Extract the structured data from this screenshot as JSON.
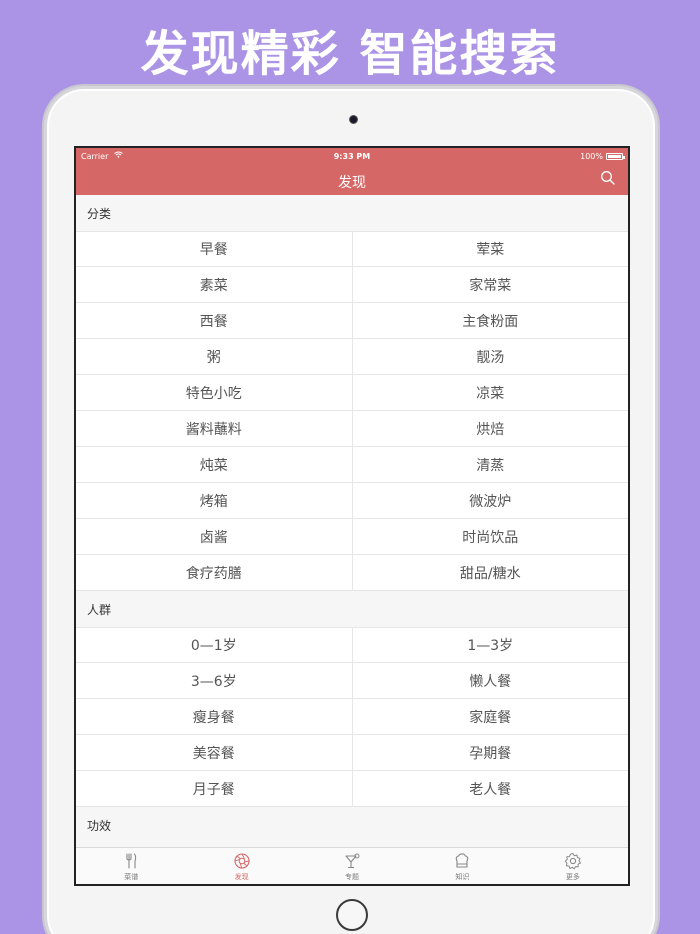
{
  "promo": {
    "title": "发现精彩 智能搜索"
  },
  "status_bar": {
    "carrier": "Carrier",
    "time": "9:33 PM",
    "battery": "100%"
  },
  "navbar": {
    "title": "发现"
  },
  "sections": [
    {
      "header": "分类",
      "rows": [
        [
          "早餐",
          "荤菜"
        ],
        [
          "素菜",
          "家常菜"
        ],
        [
          "西餐",
          "主食粉面"
        ],
        [
          "粥",
          "靓汤"
        ],
        [
          "特色小吃",
          "凉菜"
        ],
        [
          "酱料蘸料",
          "烘焙"
        ],
        [
          "炖菜",
          "清蒸"
        ],
        [
          "烤箱",
          "微波炉"
        ],
        [
          "卤酱",
          "时尚饮品"
        ],
        [
          "食疗药膳",
          "甜品/糖水"
        ]
      ]
    },
    {
      "header": "人群",
      "rows": [
        [
          "0—1岁",
          "1—3岁"
        ],
        [
          "3—6岁",
          "懒人餐"
        ],
        [
          "瘦身餐",
          "家庭餐"
        ],
        [
          "美容餐",
          "孕期餐"
        ],
        [
          "月子餐",
          "老人餐"
        ]
      ]
    },
    {
      "header": "功效",
      "rows": []
    }
  ],
  "tabbar": {
    "active_color": "#d56867",
    "items": [
      {
        "label": "菜谱",
        "icon": "fork-knife-icon"
      },
      {
        "label": "发现",
        "icon": "aperture-icon",
        "active": true
      },
      {
        "label": "专题",
        "icon": "cocktail-icon"
      },
      {
        "label": "知识",
        "icon": "chef-hat-icon"
      },
      {
        "label": "更多",
        "icon": "gear-icon"
      }
    ]
  },
  "colors": {
    "background": "#ab93e6",
    "navbar": "#d56867"
  }
}
